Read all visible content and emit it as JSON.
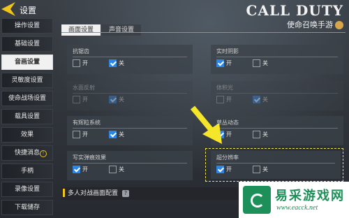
{
  "header": {
    "title": "设置",
    "logo_line1": "CALL DUTY",
    "logo_line2": "使命召唤手游"
  },
  "sidebar": {
    "items": [
      {
        "label": "操作设置"
      },
      {
        "label": "基础设置"
      },
      {
        "label": "音画设置"
      },
      {
        "label": "灵敏度设置"
      },
      {
        "label": "使命战场设置"
      },
      {
        "label": "载具设置"
      },
      {
        "label": "效果"
      },
      {
        "label": "快捷消息"
      },
      {
        "label": "手柄"
      },
      {
        "label": "录像设置"
      },
      {
        "label": "下载储存"
      }
    ]
  },
  "tabs": [
    {
      "label": "画面设置"
    },
    {
      "label": "声音设置"
    }
  ],
  "settings": {
    "anti_aliasing": {
      "label": "抗锯齿",
      "on": "开",
      "off": "关"
    },
    "realtime_shadow": {
      "label": "实时阴影",
      "on": "开",
      "off": "关"
    },
    "water": {
      "label": "水面反射",
      "on": "开",
      "off": "关"
    },
    "volume_light": {
      "label": "体积光",
      "on": "开",
      "off": "关"
    },
    "bloom": {
      "label": "有辉粒系统",
      "on": "开",
      "off": "关"
    },
    "grass": {
      "label": "草丛动态",
      "on": "开",
      "off": "关"
    },
    "realistic_bullets": {
      "label": "写实弹痕效果",
      "on": "开",
      "off": "关"
    },
    "super_resolution": {
      "label": "超分辨率",
      "on": "开",
      "off": "关"
    }
  },
  "section": {
    "title": "多人对战画面配置"
  },
  "watermark": {
    "brand": "易采游戏网",
    "url": "www.eacck.net"
  },
  "colors": {
    "accent": "#f0c419",
    "checkbox": "#2d86e6"
  }
}
